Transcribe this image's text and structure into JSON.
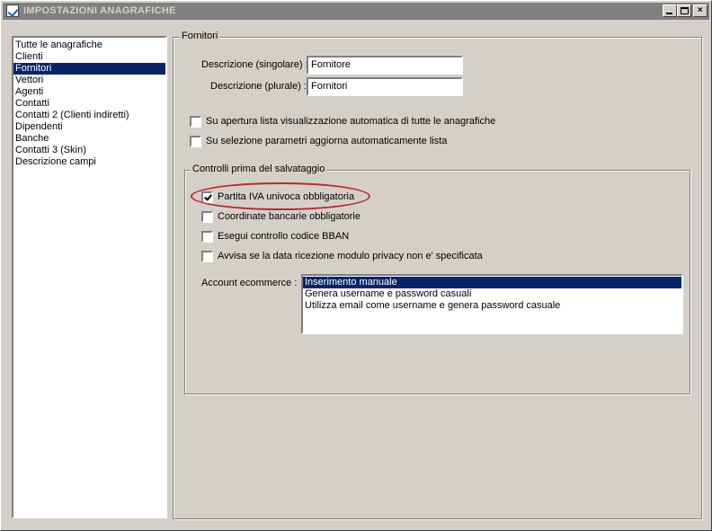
{
  "window": {
    "title": "IMPOSTAZIONI ANAGRAFICHE",
    "controls": {
      "minimize": "",
      "maximize": "",
      "close": "×"
    }
  },
  "sidebar": {
    "items": [
      {
        "label": "Tutte le anagrafiche",
        "selected": false
      },
      {
        "label": "Clienti",
        "selected": false
      },
      {
        "label": "Fornitori",
        "selected": true
      },
      {
        "label": "Vettori",
        "selected": false
      },
      {
        "label": "Agenti",
        "selected": false
      },
      {
        "label": "Contatti",
        "selected": false
      },
      {
        "label": "Contatti 2 (Clienti indiretti)",
        "selected": false
      },
      {
        "label": "Dipendenti",
        "selected": false
      },
      {
        "label": "Banche",
        "selected": false
      },
      {
        "label": "Contatti 3 (Skin)",
        "selected": false
      },
      {
        "label": "Descrizione campi",
        "selected": false
      }
    ]
  },
  "main": {
    "group_title": "Fornitori",
    "description_singular": {
      "label": "Descrizione (singolare) :",
      "value": "Fornitore"
    },
    "description_plural": {
      "label": "Descrizione (plurale) :",
      "value": "Fornitori"
    },
    "options": [
      {
        "label": "Su apertura lista visualizzazione automatica di tutte le anagrafiche",
        "checked": false
      },
      {
        "label": "Su selezione parametri aggiorna automaticamente lista",
        "checked": false
      }
    ],
    "controls_group": {
      "title": "Controlli prima del salvataggio",
      "checks": [
        {
          "label": "Partita IVA univoca obbligatoria",
          "checked": true
        },
        {
          "label": "Coordinate bancarie obbligatorie",
          "checked": false
        },
        {
          "label": "Esegui controllo codice BBAN",
          "checked": false
        },
        {
          "label": "Avvisa se la data ricezione modulo privacy non e' specificata",
          "checked": false
        }
      ],
      "account_ecommerce": {
        "label": "Account ecommerce :",
        "options": [
          {
            "label": "Inserimento manuale",
            "selected": true
          },
          {
            "label": "Genera username e password casuali",
            "selected": false
          },
          {
            "label": "Utilizza email come username e genera password casuale",
            "selected": false
          }
        ]
      }
    }
  },
  "colors": {
    "selection": "#0a246a",
    "annotation": "#c0282a",
    "titlebar_inactive": "#808080"
  }
}
